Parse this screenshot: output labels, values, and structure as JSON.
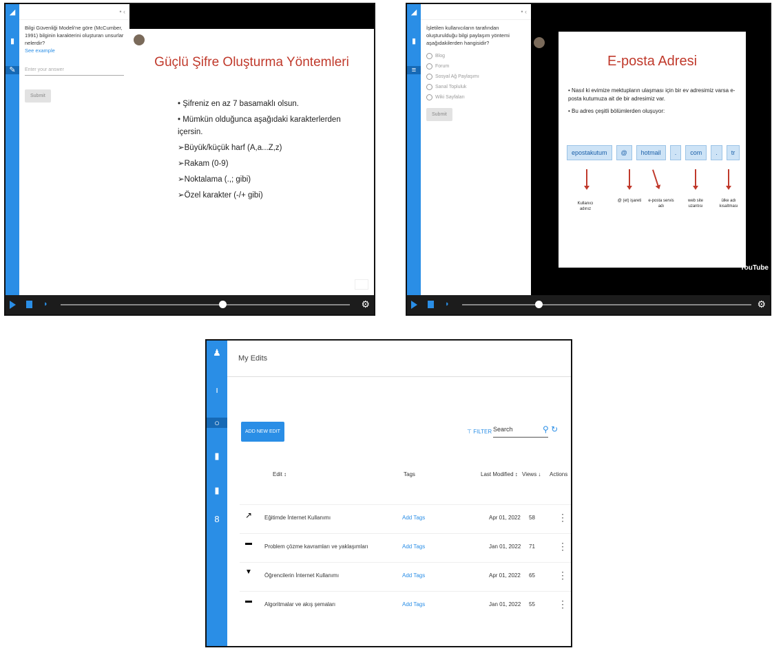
{
  "screen_a": {
    "side_question": "Bilgi Güvenliği Modeli'ne göre (McCumber, 1991) bilginin karakterini oluşturan unsurlar nelerdir?",
    "side_link": "See example",
    "answer_placeholder": "Enter your answer",
    "submit_label": "Submit",
    "slide_title": "Güçlü Şifre Oluşturma Yöntemleri",
    "bullets": [
      "• Şifreniz en az 7 basamaklı olsun.",
      "• Mümkün olduğunca aşağıdaki karakterlerden içersin.",
      "➢Büyük/küçük harf (A,a...Z,z)",
      "➢Rakam (0-9)",
      "➢Noktalama (.,; gibi)",
      "➢Özel karakter (-/+ gibi)"
    ]
  },
  "screen_b": {
    "side_question": "İşletilen kullanıcıların tarafından oluşturulduğu bilgi paylaşım yöntemi aşağıdakilerden hangisidir?",
    "options": [
      "Blog",
      "Forum",
      "Sosyal Ağ Paylaşımı",
      "Sanal Topluluk",
      "Wiki Sayfaları"
    ],
    "submit_label": "Submit",
    "slide_title": "E-posta Adresi",
    "bullets": [
      "• Nasıl ki evimize mektupların ulaşması için bir ev adresimiz varsa e-posta kutumuza ait de bir adresimiz var.",
      "• Bu adres çeşitli bölümlerden oluşuyor:"
    ],
    "parts": [
      "epostakutum",
      "@",
      "hotmail",
      ".",
      "com",
      ".",
      "tr"
    ],
    "labels": [
      "Kullanıcı adınız",
      "@ (et) işareti",
      "e-posta servis adı",
      "web site uzantısı",
      "ülke adı kısaltması"
    ],
    "youtube": "YouTube"
  },
  "screen_c": {
    "title": "My Edits",
    "add_button": "ADD NEW EDIT",
    "filter_label": "FILTER",
    "search_placeholder": "Search",
    "headers": {
      "edit": "Edit ↕",
      "tags": "Tags",
      "modified": "Last Modified ↕",
      "views": "Views ↓",
      "actions": "Actions"
    },
    "rows": [
      {
        "name": "Eğitimde İnternet Kullanımı",
        "tags": "Add Tags",
        "date": "Apr 01, 2022",
        "views": "58"
      },
      {
        "name": "Problem çözme kavramları ve yaklaşımları",
        "tags": "Add Tags",
        "date": "Jan 01, 2022",
        "views": "71"
      },
      {
        "name": "Öğrencilerin İnternet Kullanımı",
        "tags": "Add Tags",
        "date": "Apr 01, 2022",
        "views": "65"
      },
      {
        "name": "Algoritmalar ve akış şemaları",
        "tags": "Add Tags",
        "date": "Jan 01, 2022",
        "views": "55"
      }
    ]
  }
}
